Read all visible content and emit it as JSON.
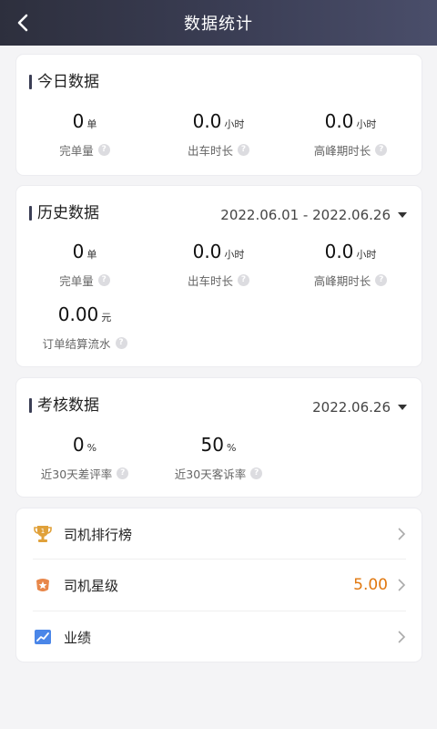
{
  "nav": {
    "title": "数据统计"
  },
  "today": {
    "title": "今日数据",
    "stats": [
      {
        "value": "0",
        "unit": "单",
        "label": "完单量"
      },
      {
        "value": "0.0",
        "unit": "小时",
        "label": "出车时长"
      },
      {
        "value": "0.0",
        "unit": "小时",
        "label": "高峰期时长"
      }
    ]
  },
  "history": {
    "title": "历史数据",
    "date_range": "2022.06.01 - 2022.06.26",
    "stats": [
      {
        "value": "0",
        "unit": "单",
        "label": "完单量"
      },
      {
        "value": "0.0",
        "unit": "小时",
        "label": "出车时长"
      },
      {
        "value": "0.0",
        "unit": "小时",
        "label": "高峰期时长"
      },
      {
        "value": "0.00",
        "unit": "元",
        "label": "订单结算流水"
      }
    ]
  },
  "assessment": {
    "title": "考核数据",
    "date": "2022.06.26",
    "stats": [
      {
        "value": "0",
        "unit": "%",
        "label": "近30天差评率"
      },
      {
        "value": "50",
        "unit": "%",
        "label": "近30天客诉率"
      }
    ]
  },
  "menu": {
    "items": [
      {
        "label": "司机排行榜",
        "icon": "trophy-icon",
        "value": ""
      },
      {
        "label": "司机星级",
        "icon": "star-badge-icon",
        "value": "5.00"
      },
      {
        "label": "业绩",
        "icon": "trend-chart-icon",
        "value": ""
      }
    ]
  },
  "colors": {
    "nav_start": "#2d2f3d",
    "nav_end": "#4a4e6a",
    "accent_orange": "#e1780f",
    "trophy": "#e0a13a",
    "chart_blue": "#4a86e8"
  }
}
